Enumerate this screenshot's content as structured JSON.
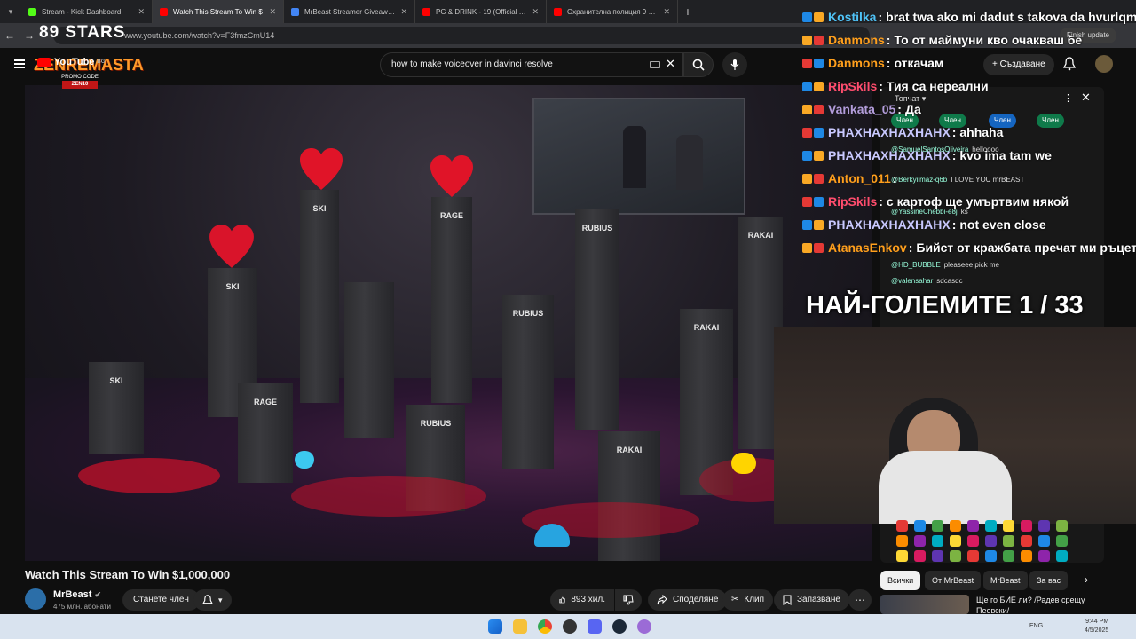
{
  "browser": {
    "tabs": [
      {
        "title": "Stream - Kick Dashboard",
        "color": "#53fc18"
      },
      {
        "title": "Watch This Stream To Win $",
        "color": "#ff0000",
        "active": true
      },
      {
        "title": "MrBeast Streamer Giveaway.pdf",
        "color": "#4285f4"
      },
      {
        "title": "PG & DRINK - 19 (Official 4K Vi",
        "color": "#ff0000"
      },
      {
        "title": "Охранителна полиция 9 РУ | Т",
        "color": "#ff0000"
      }
    ],
    "url": "www.youtube.com/watch?v=F3fmzCmU14",
    "finish_update": "Finish update"
  },
  "overlay": {
    "stars_logo": "89 STARS",
    "youtube_logo": "YouTube",
    "country": "BG",
    "promo_brand": "ZENREMASTA",
    "promo_code_label": "PROMO CODE",
    "promo_code": "ZEN10"
  },
  "youtube": {
    "search_query": "how to make voiceover in davinci resolve",
    "create_label": "Създаване"
  },
  "video": {
    "pillar_labels": [
      "SKI",
      "SKI",
      "RAGE",
      "RUBIUS",
      "RAKAI",
      "SKI",
      "RAGE",
      "RUBIUS",
      "RUBIUS",
      "RAKAI",
      "RAKAI"
    ],
    "big_title": "НАЙ-ГОЛЕМИТЕ 1 / 33"
  },
  "stream_chat": [
    {
      "name": "Kostilka",
      "color": "#4fc3f7",
      "text": "brat twa ako mi dadut s takova da hvurlqm s"
    },
    {
      "name": "Danmons",
      "color": "#ff9f1c",
      "text": "То от маймуни кво очакваш бе"
    },
    {
      "name": "Danmons",
      "color": "#ff9f1c",
      "text": "откачам"
    },
    {
      "name": "RipSkils",
      "color": "#ff4d6d",
      "text": "Тия са нереални"
    },
    {
      "name": "Vankata_05",
      "color": "#b39ddb",
      "text": "Да"
    },
    {
      "name": "PHAXHAXHAXHAHX",
      "color": "#c9c9ff",
      "text": "ahhaha"
    },
    {
      "name": "PHAXHAXHAXHAHX",
      "color": "#c9c9ff",
      "text": "kvo ima tam we"
    },
    {
      "name": "Anton_011",
      "color": "#ff9f1c",
      "text": ""
    },
    {
      "name": "RipSkils",
      "color": "#ff4d6d",
      "text": "с картоф ще умъртвим някой"
    },
    {
      "name": "PHAXHAXHAXHAHX",
      "color": "#c9c9ff",
      "text": "not even close"
    },
    {
      "name": "AtanasEnkov",
      "color": "#ff9f1c",
      "text": "Бийст от кражбата пречат ми ръцете ли"
    }
  ],
  "yt_chat": {
    "mode": "Топчат",
    "member_chips": [
      "Член",
      "Член",
      "Член",
      "Член"
    ],
    "lines": [
      {
        "name": "@SamuelSantosOliveira",
        "text": "helloooo"
      },
      {
        "name": "@Berkyilmaz-q6b",
        "text": "I LOVE YOU mrBEAST"
      },
      {
        "name": "@YassineChebbi-e8j",
        "text": "ks"
      },
      {
        "name": "@HD_BUBBLE",
        "text": "pleaseee pick me"
      },
      {
        "name": "@valensahar",
        "text": "sdcasdc"
      }
    ]
  },
  "below": {
    "title": "Watch This Stream To Win $1,000,000",
    "channel": "MrBeast",
    "subscribers": "475 млн. абонати",
    "join": "Станете член",
    "likes": "893 хил.",
    "share": "Споделяне",
    "clip": "Клип",
    "save": "Запазване",
    "chips": [
      "Всички",
      "От MrBeast",
      "MrBeast",
      "За вас"
    ],
    "rec_title": "Ще го БИЕ ли? /Радев срещу Пеевски/"
  },
  "taskbar": {
    "lang": "ENG",
    "time": "9:44 PM",
    "date": "4/5/2025"
  }
}
